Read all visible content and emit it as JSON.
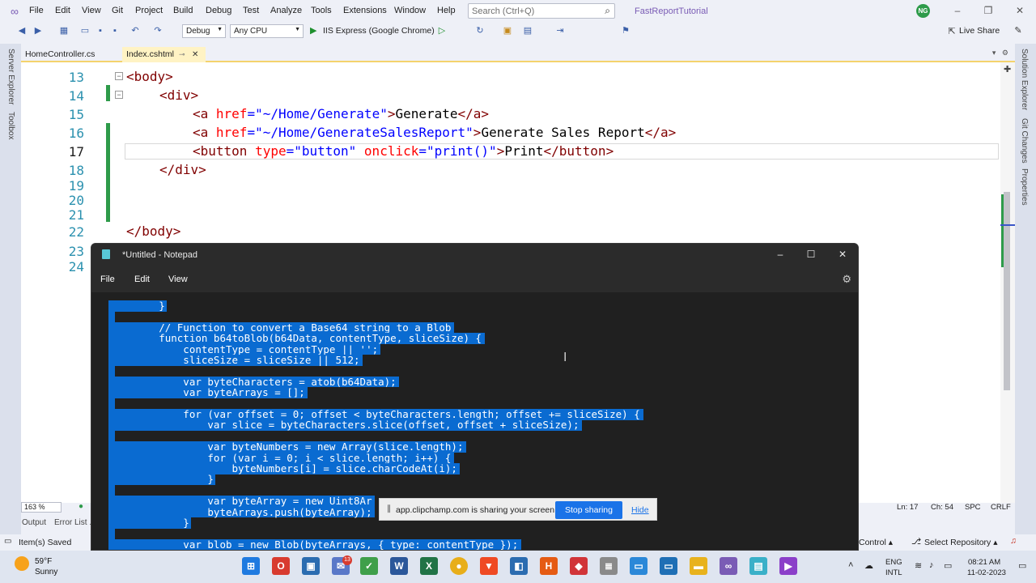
{
  "menubar": {
    "items": [
      "File",
      "Edit",
      "View",
      "Git",
      "Project",
      "Build",
      "Debug",
      "Test",
      "Analyze",
      "Tools",
      "Extensions",
      "Window",
      "Help"
    ],
    "search_placeholder": "Search (Ctrl+Q)",
    "project_name": "FastReportTutorial",
    "user_initials": "NG"
  },
  "toolbar": {
    "config": "Debug",
    "platform": "Any CPU",
    "run_target": "IIS Express (Google Chrome)",
    "live_share": "Live Share"
  },
  "side_rails": {
    "left": [
      "Server Explorer",
      "Toolbox"
    ],
    "right": [
      "Solution Explorer",
      "Git Changes",
      "Properties"
    ]
  },
  "tabs": [
    {
      "label": "HomeController.cs",
      "active": false
    },
    {
      "label": "Index.cshtml",
      "active": true
    }
  ],
  "editor": {
    "line_numbers": [
      "13",
      "14",
      "15",
      "16",
      "17",
      "18",
      "19",
      "20",
      "21",
      "22",
      "23",
      "24"
    ],
    "lines": {
      "l13": "<body>",
      "l14": "<div>",
      "l15a": "<a ",
      "l15b": "href",
      "l15c": "=\"~/Home/Generate\"",
      "l15d": ">",
      "l15e": "Generate",
      "l15f": "</a>",
      "l16a": "<a ",
      "l16b": "href",
      "l16c": "=\"~/Home/GenerateSalesReport\"",
      "l16d": ">",
      "l16e": "Generate Sales Report",
      "l16f": "</a>",
      "l17a": "<button ",
      "l17b": "type",
      "l17c": "=\"button\" ",
      "l17d": "onclick",
      "l17e": "=\"print()\"",
      "l17f": ">",
      "l17g": "Print",
      "l17h": "</button>",
      "l18": "</div>",
      "l22": "</body>"
    },
    "zoom": "163 %"
  },
  "bottom_panel": {
    "tabs": [
      "Output",
      "Error List ..."
    ],
    "status": "Item(s) Saved"
  },
  "status_right": {
    "ln": "Ln: 17",
    "ch": "Ch: 54",
    "spc": "SPC",
    "crlf": "CRLF",
    "control": "Control",
    "repo": "Select Repository"
  },
  "notepad": {
    "title": "*Untitled - Notepad",
    "menu": [
      "File",
      "Edit",
      "View"
    ],
    "lines": [
      "        }",
      "",
      "        // Function to convert a Base64 string to a Blob",
      "        function b64toBlob(b64Data, contentType, sliceSize) {",
      "            contentType = contentType || '';",
      "            sliceSize = sliceSize || 512;",
      "",
      "            var byteCharacters = atob(b64Data);",
      "            var byteArrays = [];",
      "",
      "            for (var offset = 0; offset < byteCharacters.length; offset += sliceSize) {",
      "                var slice = byteCharacters.slice(offset, offset + sliceSize);",
      "",
      "                var byteNumbers = new Array(slice.length);",
      "                for (var i = 0; i < slice.length; i++) {",
      "                    byteNumbers[i] = slice.charCodeAt(i);",
      "                }",
      "",
      "                var byteArray = new Uint8Ar",
      "                byteArrays.push(byteArray);",
      "            }",
      "",
      "            var blob = new Blob(byteArrays, { type: contentType });"
    ]
  },
  "share_banner": {
    "text": "app.clipchamp.com is sharing your screen.",
    "stop": "Stop sharing",
    "hide": "Hide"
  },
  "taskbar": {
    "temperature": "59°F",
    "condition": "Sunny",
    "lang1": "ENG",
    "lang2": "INTL",
    "time": "08:21 AM",
    "date": "11-02-2023",
    "badge": "13"
  }
}
